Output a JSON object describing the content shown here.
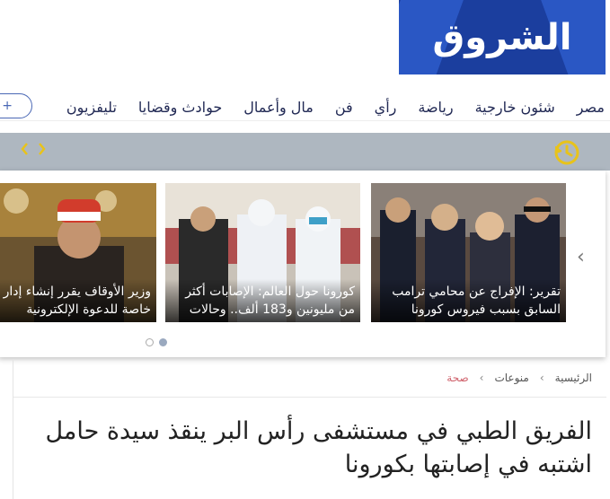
{
  "logo": {
    "text": "الشروق"
  },
  "nav": {
    "items": [
      "مصر",
      "شئون خارجية",
      "رياضة",
      "رأي",
      "فن",
      "مال وأعمال",
      "حوادث وقضايا",
      "تليفزيون"
    ],
    "more": "+ أق"
  },
  "colors": {
    "brand": "#1b3e9e",
    "band": "#aeb7c0",
    "history": "#e8c31a",
    "accent_red": "#d0646e"
  },
  "slider": {
    "slides": [
      {
        "line1": "تقرير: الإفراج عن محامي ترامب",
        "line2": "السابق بسبب فيروس كورونا"
      },
      {
        "line1": "كورونا حول العالم: الإصابات أكثر",
        "line2": "من مليونين و183 ألف.. وحالات"
      },
      {
        "line1": "وزير الأوقاف يقرر إنشاء إدار",
        "line2": "خاصة للدعوة الإلكترونية"
      }
    ]
  },
  "breadcrumb": {
    "home": "الرئيسية",
    "section": "منوعات",
    "current": "صحة"
  },
  "article": {
    "title_line1": "الفريق الطبي في مستشفى رأس البر ينقذ سيدة حامل",
    "title_line2": "اشتبه في إصابتها بكورونا"
  }
}
